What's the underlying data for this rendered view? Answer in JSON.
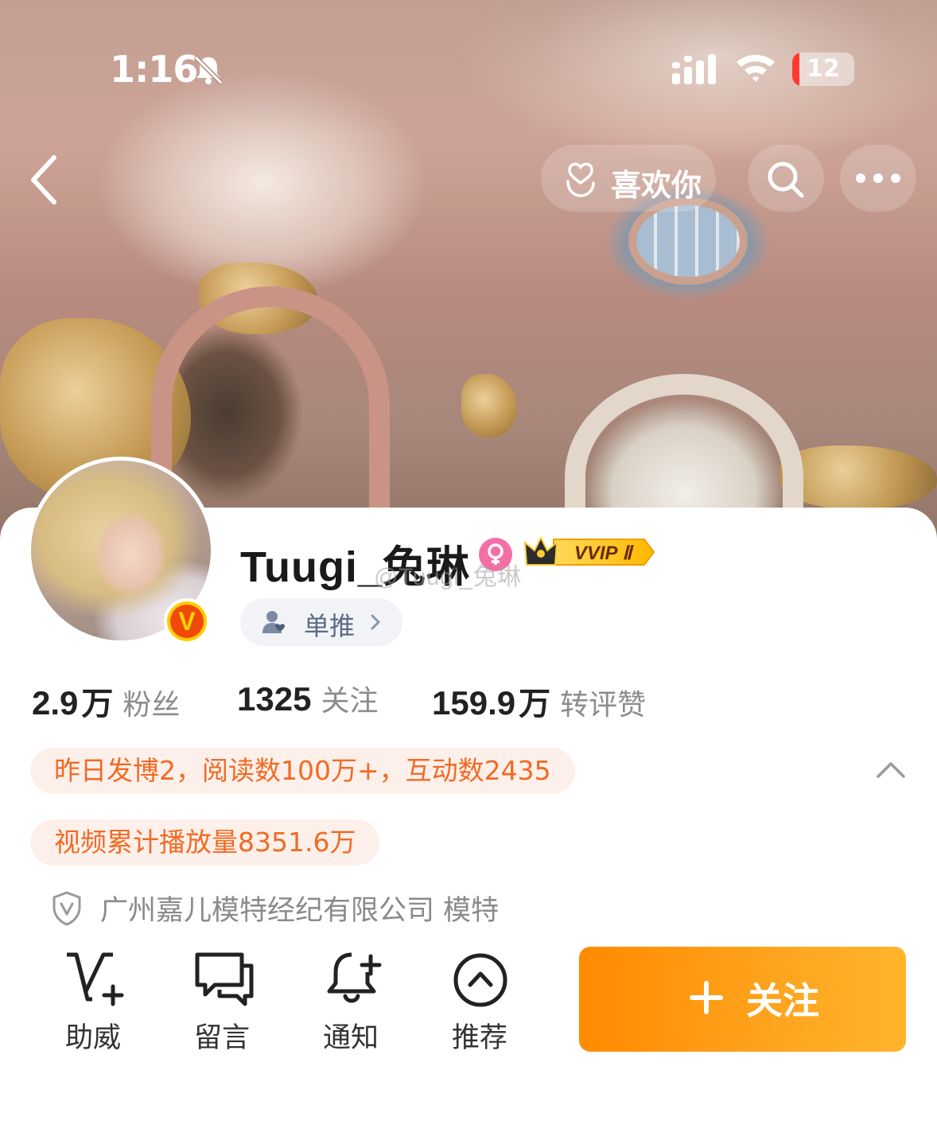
{
  "status_bar": {
    "time": "1:16",
    "battery_level": "12",
    "battery_fraction": 0.12,
    "icons": [
      "bell-muted-icon",
      "cellular-signal-icon",
      "wifi-icon",
      "battery-icon"
    ]
  },
  "nav": {
    "like_label": "喜欢你",
    "icons": [
      "back-chevron-icon",
      "heart-hand-icon",
      "search-icon",
      "more-dots-icon"
    ]
  },
  "profile": {
    "username": "Tuugi_兔琳",
    "watermark": "@Tuugi_兔琳",
    "verified_letter": "V",
    "vip_label": "VVIP Ⅱ",
    "tag_label": "单推",
    "icons": [
      "avatar-photo",
      "verified-v-badge",
      "female-gender-icon",
      "crown-icon",
      "person-tag-icon",
      "chevron-right-icon"
    ]
  },
  "stats": {
    "followers": {
      "num": "2.9",
      "unit": "万",
      "label": "粉丝"
    },
    "following": {
      "num": "1325",
      "unit": "",
      "label": "关注"
    },
    "engagement": {
      "num": "159.9",
      "unit": "万",
      "label": "转评赞"
    }
  },
  "highlights": {
    "yesterday": "昨日发博2，阅读数100万+，互动数2435",
    "video": "视频累计播放量8351.6万"
  },
  "certification": {
    "text": "广州嘉儿模特经纪有限公司 模特",
    "icon": "shield-v-icon"
  },
  "actions": [
    {
      "label": "助威",
      "icon": "v-plus-icon"
    },
    {
      "label": "留言",
      "icon": "chat-bubbles-icon"
    },
    {
      "label": "通知",
      "icon": "bell-plus-icon"
    },
    {
      "label": "推荐",
      "icon": "chevron-up-circle-icon"
    }
  ],
  "follow_button": {
    "label": "关注",
    "icon": "plus-icon"
  },
  "colors": {
    "accent_orange": "#ff8a00",
    "highlight_text": "#f26a23",
    "highlight_bg": "#fdf0ea",
    "tag_bg": "#f2f3f6"
  }
}
